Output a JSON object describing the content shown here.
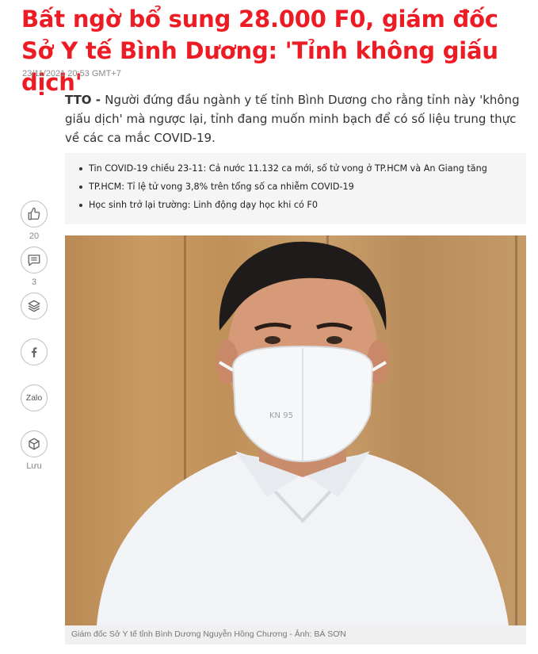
{
  "article": {
    "title": "Bất ngờ bổ sung 28.000 F0, giám đốc Sở Y tế Bình Dương: 'Tỉnh không giấu dịch'",
    "date": "23/11/2021 20:53 GMT+7",
    "sapo_lead": "TTO - ",
    "sapo_body": "Người đứng đầu ngành y tế tỉnh Bình Dương cho rằng tỉnh này 'không giấu dịch' mà ngược lại, tỉnh đang muốn minh bạch để có số liệu trung thực về các ca mắc COVID-19."
  },
  "related": [
    "Tin COVID-19 chiều 23-11: Cả nước 11.132 ca mới, số tử vong ở TP.HCM và An Giang tăng",
    "TP.HCM: Tỉ lệ tử vong 3,8% trên tổng số ca nhiễm COVID-19",
    "Học sinh trở lại trường: Linh động dạy học khi có F0"
  ],
  "social": {
    "like_count": "20",
    "comment_count": "3",
    "zalo_label": "Zalo",
    "save_label": "Lưu",
    "icons": [
      "thumbs-up-icon",
      "comment-icon",
      "layers-icon",
      "facebook-icon",
      "zalo-icon",
      "save-icon"
    ]
  },
  "photo": {
    "mask_text": "KN 95",
    "caption": "Giám đốc Sở Y tế tỉnh Bình Dương Nguyễn Hồng Chương - Ảnh: BÁ SƠN"
  },
  "colors": {
    "title": "#ed1c24",
    "related_bg": "#f5f5f5",
    "caption_bg": "#f0f0f0"
  }
}
